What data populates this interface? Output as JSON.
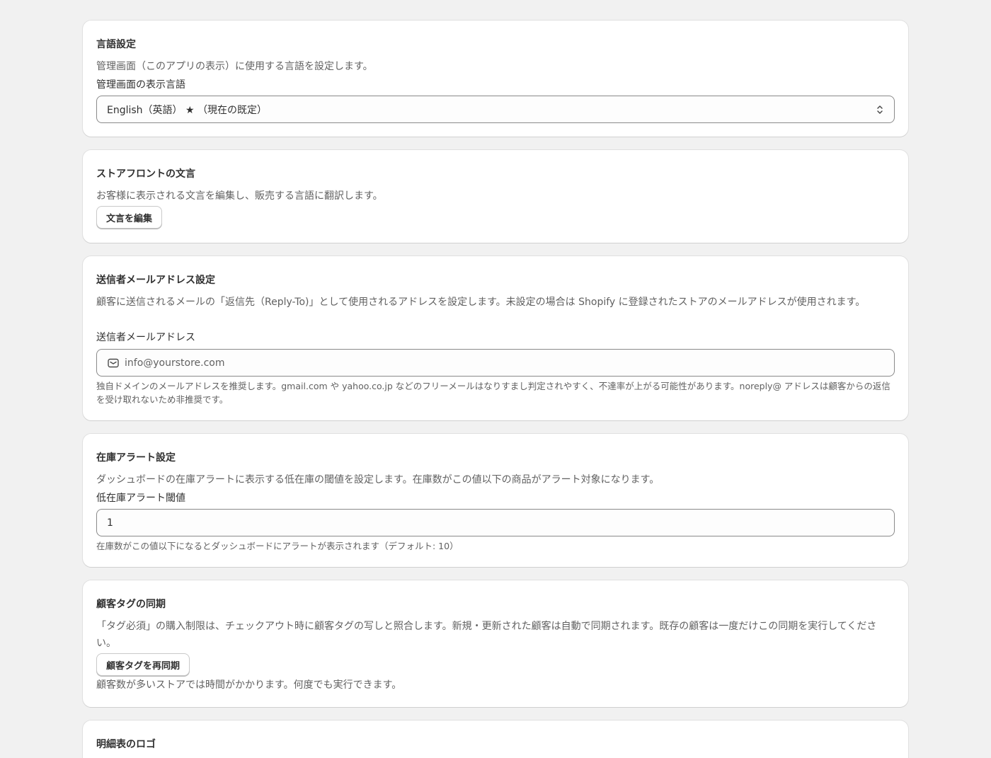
{
  "language": {
    "title": "言語設定",
    "description": "管理画面（このアプリの表示）に使用する言語を設定します。",
    "field_label": "管理画面の表示言語",
    "selected_value": "English（英語） ★ （現在の既定）"
  },
  "storefront": {
    "title": "ストアフロントの文言",
    "description": "お客様に表示される文言を編集し、販売する言語に翻訳します。",
    "button_label": "文言を編集"
  },
  "sender_email": {
    "title": "送信者メールアドレス設定",
    "description": "顧客に送信されるメールの「返信先（Reply-To)」として使用されるアドレスを設定します。未設定の場合は Shopify に登録されたストアのメールアドレスが使用されます。",
    "field_label": "送信者メールアドレス",
    "placeholder": "info@yourstore.com",
    "help": "独自ドメインのメールアドレスを推奨します。gmail.com や yahoo.co.jp などのフリーメールはなりすまし判定されやすく、不達率が上がる可能性があります。noreply@ アドレスは顧客からの返信を受け取れないため非推奨です。"
  },
  "inventory_alert": {
    "title": "在庫アラート設定",
    "description": "ダッシュボードの在庫アラートに表示する低在庫の閾値を設定します。在庫数がこの値以下の商品がアラート対象になります。",
    "field_label": "低在庫アラート閾値",
    "value": "1",
    "help": "在庫数がこの値以下になるとダッシュボードにアラートが表示されます（デフォルト: 10）"
  },
  "customer_tags": {
    "title": "顧客タグの同期",
    "description": "「タグ必須」の購入制限は、チェックアウト時に顧客タグの写しと照合します。新規・更新された顧客は自動で同期されます。既存の顧客は一度だけこの同期を実行してください。",
    "button_label": "顧客タグを再同期",
    "help": "顧客数が多いストアでは時間がかかります。何度でも実行できます。"
  },
  "invoice_logo": {
    "title": "明細表のロゴ"
  },
  "icons": {
    "select": "chevron-up-down-icon",
    "email": "mail-icon"
  },
  "colors": {
    "background": "#f1f1f1",
    "card": "#ffffff",
    "text": "#303030",
    "subdued": "#616161",
    "border": "#8a8a8a"
  }
}
